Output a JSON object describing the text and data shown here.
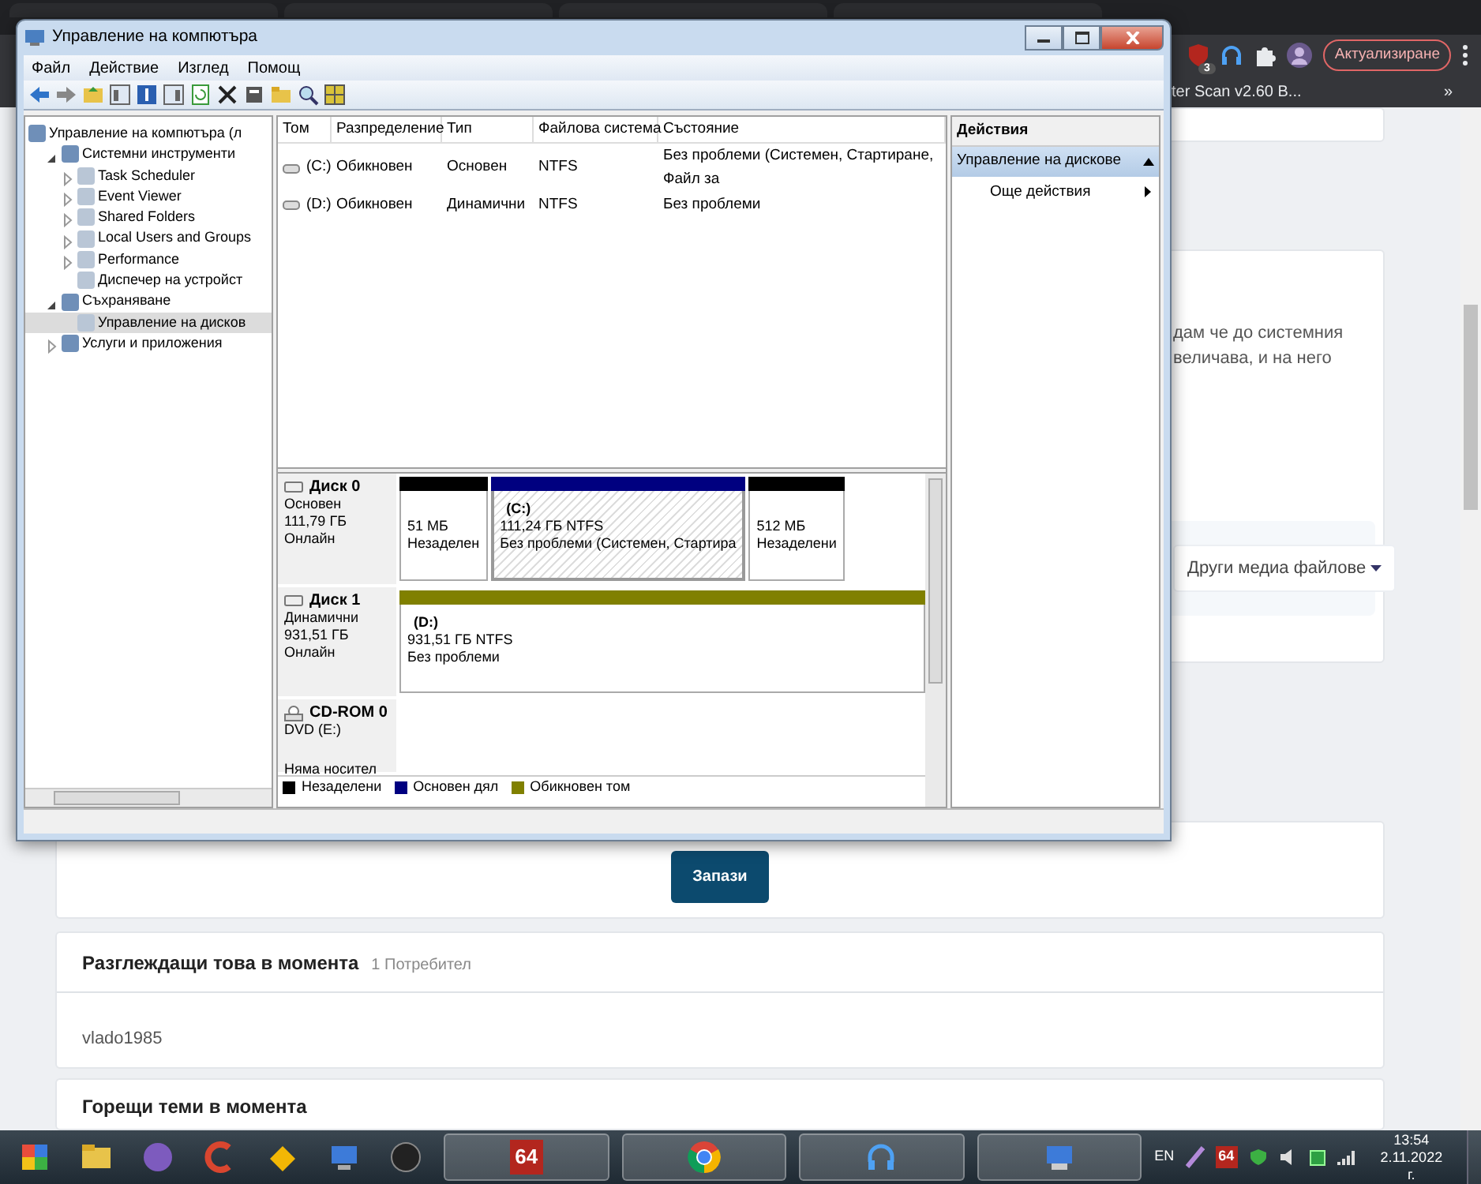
{
  "browser": {
    "extension_badge": "3",
    "update_button": "Актуализиране",
    "bookmark": "ter Scan v2.60 B...",
    "bookmarks_more": "»"
  },
  "window": {
    "title": "Управление на компютъра",
    "menu": [
      "Файл",
      "Действие",
      "Изглед",
      "Помощ"
    ],
    "tree": [
      {
        "label": "Управление на компютъра (л",
        "selected": false,
        "children": [
          {
            "label": "Системни инструменти",
            "expanded": true,
            "selected": false,
            "children": [
              {
                "label": "Task Scheduler",
                "expanded": false,
                "selected": false
              },
              {
                "label": "Event Viewer",
                "expanded": false,
                "selected": false
              },
              {
                "label": "Shared Folders",
                "expanded": false,
                "selected": false
              },
              {
                "label": "Local Users and Groups",
                "expanded": false,
                "selected": false
              },
              {
                "label": "Performance",
                "expanded": false,
                "selected": false
              },
              {
                "label": "Диспечер на устройст",
                "selected": false
              }
            ]
          },
          {
            "label": "Съхраняване",
            "expanded": true,
            "selected": false,
            "children": [
              {
                "label": "Управление на дисков",
                "selected": true
              }
            ]
          },
          {
            "label": "Услуги и приложения",
            "expanded": false,
            "selected": false
          }
        ]
      }
    ],
    "volumes": {
      "columns": [
        "Том",
        "Разпределение",
        "Тип",
        "Файлова система",
        "Състояние"
      ],
      "rows": [
        {
          "cells": [
            "(C:)",
            "Обикновен",
            "Основен",
            "NTFS",
            "Без проблеми (Системен, Стартиране, Файл за"
          ]
        },
        {
          "cells": [
            "(D:)",
            "Обикновен",
            "Динамични",
            "NTFS",
            "Без проблеми"
          ]
        }
      ]
    },
    "disks": [
      {
        "kind": "disk",
        "name": "Диск 0",
        "type": "Основен",
        "size": "111,79 ГБ",
        "status": "Онлайн",
        "partitions": [
          {
            "color": "#000000",
            "selected": false,
            "lines": [
              "51 МБ",
              "Незаделен"
            ]
          },
          {
            "color": "#000080",
            "selected": true,
            "title": "(C:)",
            "lines": [
              "111,24 ГБ NTFS",
              "Без проблеми (Системен, Стартира"
            ]
          },
          {
            "color": "#000000",
            "selected": false,
            "lines": [
              "512 МБ",
              "Незаделени"
            ]
          }
        ]
      },
      {
        "kind": "disk",
        "name": "Диск 1",
        "type": "Динамични",
        "size": "931,51 ГБ",
        "status": "Онлайн",
        "partitions": [
          {
            "color": "#808000",
            "selected": false,
            "title": "(D:)",
            "lines": [
              "931,51 ГБ NTFS",
              "Без проблеми"
            ]
          }
        ]
      },
      {
        "kind": "cdrom",
        "name": "CD-ROM 0",
        "type": "DVD (E:)",
        "status": "Няма носител"
      }
    ],
    "legend": [
      {
        "label": "Незаделени",
        "color": "#000000"
      },
      {
        "label": "Основен дял",
        "color": "#000080"
      },
      {
        "label": "Обикновен том",
        "color": "#808000"
      }
    ],
    "actions": {
      "title": "Действия",
      "section": "Управление на дискове",
      "expanded": true,
      "items": [
        "Още действия"
      ]
    }
  },
  "page": {
    "post_lines": [
      "дам че до системния",
      "величава, и на него"
    ],
    "media_button": "Други медиа файлове",
    "save_button": "Запази",
    "viewers": {
      "title": "Разглеждащи това в момента",
      "count": "1 Потребител",
      "users": [
        "vlado1985"
      ]
    },
    "hot_topics": {
      "title": "Горещи теми в момента"
    }
  },
  "taskbar": {
    "pinned_label": "64",
    "language": "EN",
    "tray_badge": "64",
    "time": "13:54",
    "date": "2.11.2022 г."
  }
}
